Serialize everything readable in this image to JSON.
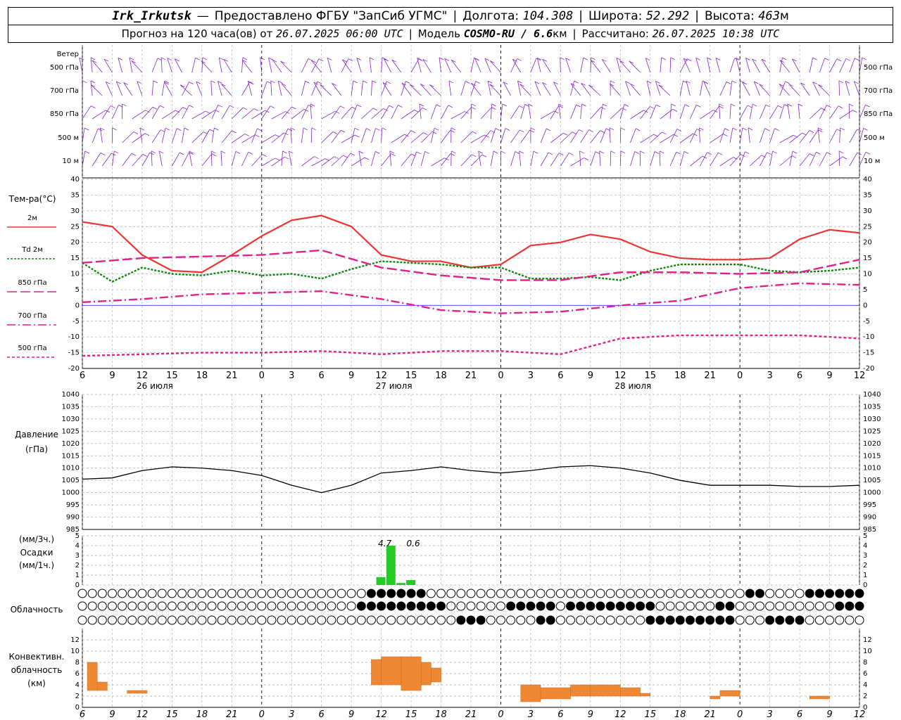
{
  "header": {
    "station": "Irk_Irkutsk",
    "dash": "—",
    "provider": "Предоставлено ФГБУ \"ЗапСиб УГМС\"",
    "lon_label": "Долгота:",
    "lon": "104.308",
    "lat_label": "Широта:",
    "lat": "52.292",
    "alt_label": "Высота:",
    "alt": "463",
    "alt_unit": "м",
    "forecast_label": "Прогноз на 120 часа(ов)  от",
    "forecast_time": "26.07.2025 06:00 UTC",
    "model_label": "Модель",
    "model": "COSMO-RU / 6.6",
    "model_unit": "км",
    "calc_label": "Рассчитано:",
    "calc_time": "26.07.2025 10:38 UTC"
  },
  "colors": {
    "t2m": "#ee3333",
    "td": "#118811",
    "t850": "#dd2288",
    "t700": "#dd2288",
    "t500": "#dd2288",
    "wind": "#8822cc",
    "pressure": "#000000",
    "precip": "#22cc22",
    "convective": "#ee8833",
    "zero_line": "#3333ff"
  },
  "chart_data": [
    {
      "type": "wind_barbs",
      "title": "Ветер",
      "levels": [
        "500 гПа",
        "700 гПа",
        "850 гПа",
        "500 м",
        "10 м"
      ]
    },
    {
      "type": "line",
      "title": "Тем-ра(°C)",
      "ylim": [
        -20,
        40
      ],
      "y_ticks": [
        40,
        35,
        30,
        25,
        20,
        15,
        10,
        5,
        0,
        -5,
        -10,
        -15,
        -20
      ],
      "x_hours": [
        0,
        6,
        12,
        18,
        24,
        30,
        36,
        42,
        48,
        54
      ],
      "x_tick_labels": [
        "6",
        "9",
        "12",
        "15",
        "18",
        "21",
        "0",
        "3",
        "6",
        "9",
        "12",
        "15",
        "18",
        "21",
        "0",
        "3",
        "6",
        "9",
        "12",
        "15",
        "18",
        "21",
        "0",
        "3",
        "6",
        "9",
        "12"
      ],
      "date_labels": [
        "26 июля",
        "27 июля",
        "28 июля"
      ],
      "series": [
        {
          "name": "2м",
          "style": "solid",
          "x": [
            0,
            3,
            6,
            9,
            12,
            15,
            18,
            21,
            24,
            27,
            30,
            33,
            36,
            39,
            42,
            45,
            48,
            51,
            54,
            57,
            60,
            63,
            66,
            69,
            72,
            75,
            78
          ],
          "values": [
            26.5,
            25,
            16,
            11,
            10.5,
            16,
            22,
            27,
            28.5,
            25,
            16,
            14,
            14,
            12,
            13,
            19,
            20,
            22.5,
            21,
            17,
            15,
            14.5,
            14.5,
            15,
            21,
            24,
            23
          ]
        },
        {
          "name": "Td 2м",
          "style": "dotted",
          "x": [
            0,
            3,
            6,
            9,
            12,
            15,
            18,
            21,
            24,
            27,
            30,
            33,
            36,
            39,
            42,
            45,
            48,
            51,
            54,
            57,
            60,
            63,
            66,
            69,
            72,
            75,
            78
          ],
          "values": [
            13.5,
            7.5,
            12,
            10,
            9.5,
            11,
            9.5,
            10,
            8.5,
            11.5,
            14,
            13.5,
            13,
            12,
            12,
            8.5,
            8.5,
            9,
            8,
            11,
            13,
            13,
            13,
            11,
            10.5,
            11,
            12
          ]
        },
        {
          "name": "850 гПа",
          "style": "longdash",
          "x": [
            0,
            6,
            12,
            18,
            24,
            30,
            36,
            42,
            48,
            54,
            60,
            66,
            72,
            78
          ],
          "values": [
            13.5,
            15,
            15.5,
            16,
            17.5,
            12,
            9.5,
            8,
            8,
            10.5,
            10.5,
            10,
            10.5,
            14.5
          ]
        },
        {
          "name": "700 гПа",
          "style": "dashdot",
          "x": [
            0,
            6,
            12,
            18,
            24,
            30,
            36,
            42,
            48,
            54,
            60,
            66,
            72,
            78
          ],
          "values": [
            1,
            2,
            3.5,
            4,
            4.5,
            2,
            -1.5,
            -2.5,
            -2,
            0,
            1.5,
            5.5,
            7,
            6.5
          ]
        },
        {
          "name": "500 гПа",
          "style": "dashed",
          "x": [
            0,
            6,
            12,
            18,
            24,
            30,
            36,
            42,
            48,
            54,
            60,
            66,
            72,
            78
          ],
          "values": [
            -16,
            -15.5,
            -15,
            -15,
            -14.5,
            -15.5,
            -14.5,
            -14.5,
            -15.5,
            -10.5,
            -9.5,
            -9.5,
            -9.5,
            -10.5
          ]
        }
      ]
    },
    {
      "type": "line",
      "title": "Давление",
      "subtitle": "(гПа)",
      "ylim": [
        985,
        1040
      ],
      "y_ticks": [
        1040,
        1035,
        1030,
        1025,
        1020,
        1015,
        1010,
        1005,
        1000,
        995,
        990,
        985
      ],
      "series": [
        {
          "name": "",
          "x": [
            0,
            3,
            6,
            9,
            12,
            15,
            18,
            21,
            24,
            27,
            30,
            33,
            36,
            39,
            42,
            45,
            48,
            51,
            54,
            57,
            60,
            63,
            66,
            69,
            72,
            75,
            78
          ],
          "values": [
            1005.5,
            1006,
            1009,
            1010.5,
            1010,
            1009,
            1007,
            1003,
            1000,
            1003,
            1008,
            1009,
            1010.5,
            1009,
            1008,
            1009,
            1010.5,
            1011,
            1010,
            1008,
            1005,
            1003,
            1003,
            1003,
            1002.5,
            1002.5,
            1003
          ]
        }
      ]
    },
    {
      "type": "bar",
      "title": "Осадки",
      "ylabel_top": "(мм/3ч.)",
      "ylabel_bottom": "(мм/1ч.)",
      "ylim": [
        0,
        5
      ],
      "y_ticks": [
        5,
        4,
        3,
        2,
        1,
        0
      ],
      "annotations": [
        "4.7",
        "0.6"
      ],
      "bars": [
        {
          "x": 30,
          "value": 0.8
        },
        {
          "x": 31,
          "value": 4.0
        },
        {
          "x": 32,
          "value": 0.2
        },
        {
          "x": 33,
          "value": 0.5
        }
      ]
    },
    {
      "type": "cloud_cover",
      "title": "Облачность"
    },
    {
      "type": "bar",
      "title": "Конвективн.",
      "subtitle": "облачность",
      "ylabel": "(км)",
      "ylim": [
        0,
        14
      ],
      "y_ticks": [
        12,
        10,
        8,
        6,
        4,
        2,
        0
      ],
      "ranges": [
        {
          "x0": 0.5,
          "x1": 1.5,
          "lo": 3,
          "hi": 8
        },
        {
          "x0": 1.5,
          "x1": 2.5,
          "lo": 3,
          "hi": 4.5
        },
        {
          "x0": 4.5,
          "x1": 6.5,
          "lo": 2.5,
          "hi": 3
        },
        {
          "x0": 29,
          "x1": 30,
          "lo": 4,
          "hi": 8.5
        },
        {
          "x0": 30,
          "x1": 32,
          "lo": 4,
          "hi": 9
        },
        {
          "x0": 32,
          "x1": 34,
          "lo": 3,
          "hi": 9
        },
        {
          "x0": 34,
          "x1": 35,
          "lo": 4,
          "hi": 8
        },
        {
          "x0": 35,
          "x1": 36,
          "lo": 4.5,
          "hi": 7
        },
        {
          "x0": 44,
          "x1": 46,
          "lo": 1,
          "hi": 4
        },
        {
          "x0": 46,
          "x1": 49,
          "lo": 1.5,
          "hi": 3.5
        },
        {
          "x0": 49,
          "x1": 51,
          "lo": 2,
          "hi": 4
        },
        {
          "x0": 51,
          "x1": 54,
          "lo": 2,
          "hi": 4
        },
        {
          "x0": 54,
          "x1": 56,
          "lo": 2,
          "hi": 3.5
        },
        {
          "x0": 56,
          "x1": 57,
          "lo": 2,
          "hi": 2.5
        },
        {
          "x0": 63,
          "x1": 64,
          "lo": 1.5,
          "hi": 2
        },
        {
          "x0": 64,
          "x1": 66,
          "lo": 2,
          "hi": 3
        },
        {
          "x0": 73,
          "x1": 75,
          "lo": 1.5,
          "hi": 2
        }
      ]
    }
  ]
}
